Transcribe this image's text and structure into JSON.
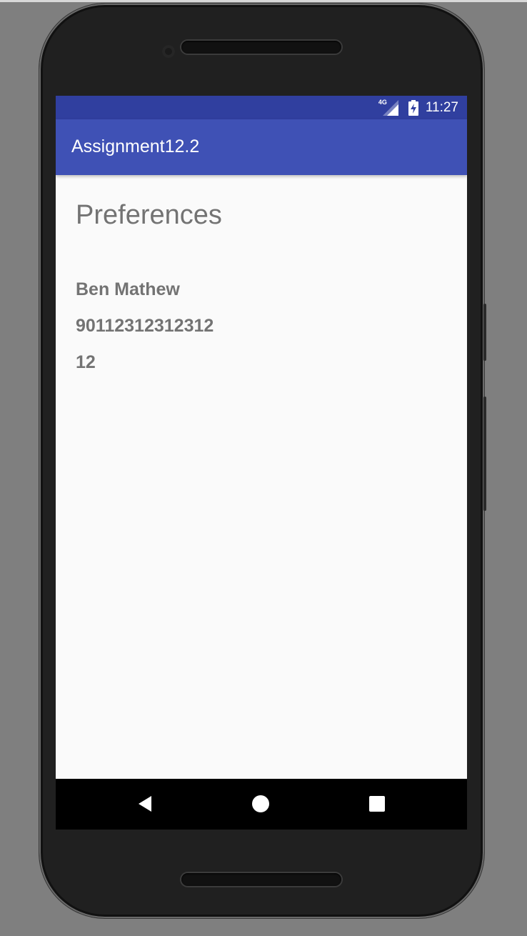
{
  "status_bar": {
    "network": "4G",
    "time": "11:27"
  },
  "app_bar": {
    "title": "Assignment12.2"
  },
  "content": {
    "heading": "Preferences",
    "values": [
      "Ben Mathew",
      "90112312312312",
      "12"
    ]
  },
  "nav_bar": {
    "back": "back-icon",
    "home": "home-icon",
    "recents": "recents-icon"
  },
  "colors": {
    "status_bar": "#303f9f",
    "app_bar": "#3f51b5",
    "background": "#fafafa",
    "text": "#737373",
    "nav_bar": "#000000"
  }
}
